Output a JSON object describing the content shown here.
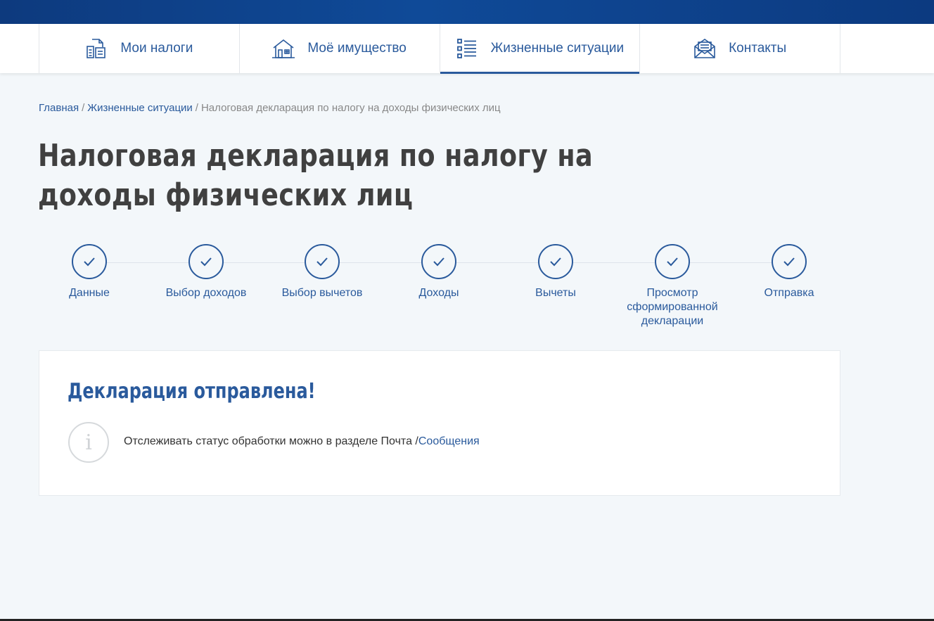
{
  "nav": {
    "items": [
      {
        "label": "Мои налоги",
        "icon": "tax-documents-icon",
        "active": false
      },
      {
        "label": "Моё имущество",
        "icon": "house-icon",
        "active": false
      },
      {
        "label": "Жизненные ситуации",
        "icon": "list-icon",
        "active": true
      },
      {
        "label": "Контакты",
        "icon": "envelope-icon",
        "active": false
      }
    ]
  },
  "breadcrumb": {
    "home": "Главная",
    "section": "Жизненные ситуации",
    "current": "Налоговая декларация по налогу на доходы физических лиц",
    "separator": "/"
  },
  "page": {
    "title": "Налоговая декларация по налогу на доходы физических лиц"
  },
  "steps": [
    {
      "label": "Данные"
    },
    {
      "label": "Выбор доходов"
    },
    {
      "label": "Выбор вычетов"
    },
    {
      "label": "Доходы"
    },
    {
      "label": "Вычеты"
    },
    {
      "label": "Просмотр сформированной декларации"
    },
    {
      "label": "Отправка"
    }
  ],
  "result": {
    "title": "Декларация отправлена!",
    "info_icon": "info-icon",
    "info_glyph": "i",
    "message": "Отслеживать статус обработки можно в разделе Почта /",
    "link": "Сообщения"
  },
  "colors": {
    "accent": "#2a5a9c",
    "header": "#0f4a98",
    "background": "#f3f7fa"
  }
}
